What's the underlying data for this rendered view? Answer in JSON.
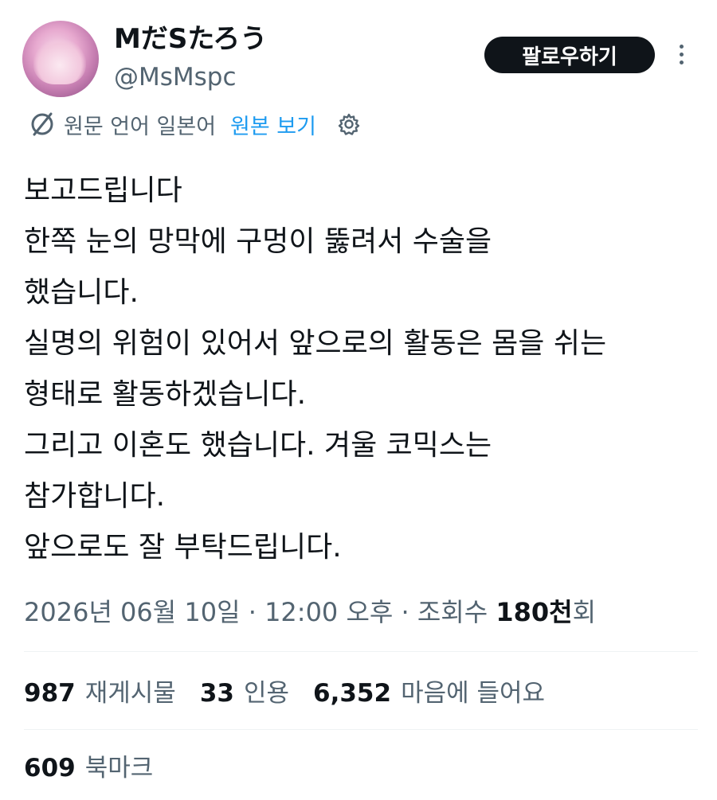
{
  "author": {
    "display_name": "MだSたろう",
    "handle": "@MsMspc"
  },
  "header": {
    "follow_label": "팔로우하기"
  },
  "translation": {
    "source_language": "원문 언어 일본어",
    "view_original": "원본 보기"
  },
  "tweet": {
    "lines": [
      "보고드립니다",
      "한쪽 눈의 망막에 구멍이 뚫려서 수술을",
      "했습니다.",
      "실명의 위험이 있어서 앞으로의 활동은 몸을 쉬는",
      "형태로 활동하겠습니다.",
      "그리고 이혼도 했습니다. 겨울 코믹스는",
      "참가합니다.",
      "앞으로도 잘 부탁드립니다."
    ]
  },
  "meta": {
    "date": "2026년 06월 10일",
    "separator": " · ",
    "time": "12:00 오후",
    "views_prefix": "조회수 ",
    "views_number": "180천",
    "views_suffix": "회"
  },
  "stats": {
    "retweets_count": "987",
    "retweets_label": "재게시물",
    "quotes_count": "33",
    "quotes_label": "인용",
    "likes_count": "6,352",
    "likes_label": "마음에 들어요",
    "bookmarks_count": "609",
    "bookmarks_label": "북마크"
  },
  "colors": {
    "text_primary": "#0f1419",
    "text_secondary": "#536471",
    "link": "#1d9bf0",
    "button_bg": "#0f1419",
    "divider": "#eff3f4"
  },
  "icons": [
    "avatar",
    "translate-icon",
    "gear-icon",
    "more-icon"
  ]
}
